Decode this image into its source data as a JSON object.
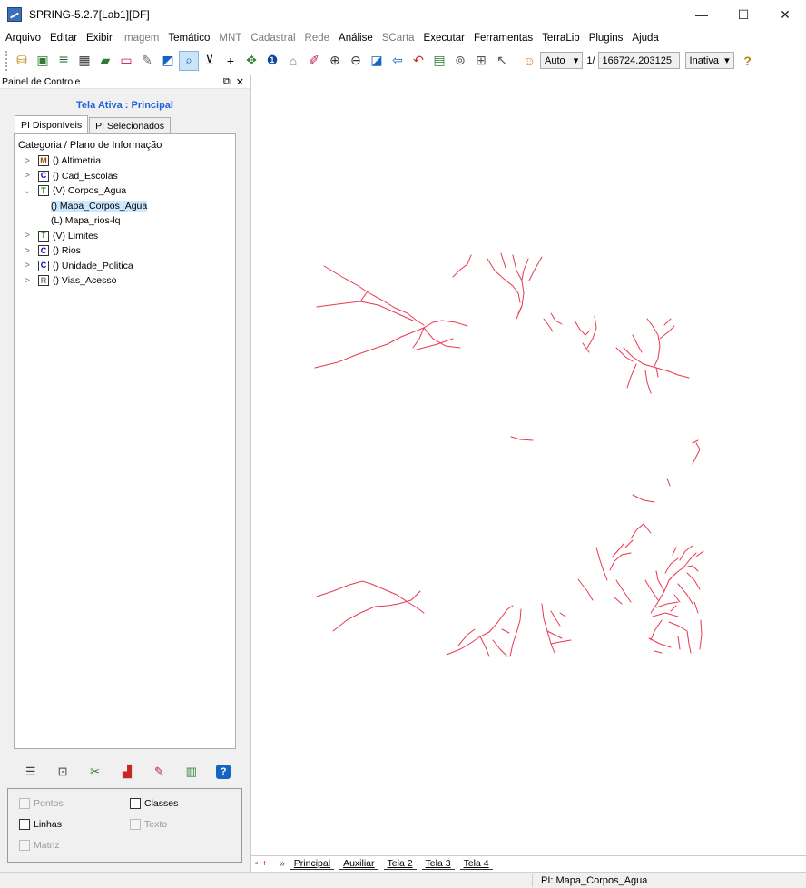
{
  "window": {
    "title": "SPRING-5.2.7[Lab1][DF]",
    "minimize": "—",
    "maximize": "☐",
    "close": "✕"
  },
  "menu": [
    {
      "label": "Arquivo",
      "enabled": true
    },
    {
      "label": "Editar",
      "enabled": true
    },
    {
      "label": "Exibir",
      "enabled": true
    },
    {
      "label": "Imagem",
      "enabled": false
    },
    {
      "label": "Temático",
      "enabled": true
    },
    {
      "label": "MNT",
      "enabled": false
    },
    {
      "label": "Cadastral",
      "enabled": false
    },
    {
      "label": "Rede",
      "enabled": false
    },
    {
      "label": "Análise",
      "enabled": true
    },
    {
      "label": "SCarta",
      "enabled": false
    },
    {
      "label": "Executar",
      "enabled": true
    },
    {
      "label": "Ferramentas",
      "enabled": true
    },
    {
      "label": "TerraLib",
      "enabled": true
    },
    {
      "label": "Plugins",
      "enabled": true
    },
    {
      "label": "Ajuda",
      "enabled": true
    }
  ],
  "toolbar": {
    "zoom_mode": "Auto",
    "scale_prefix": "1/",
    "scale_value": "166724.203125",
    "status_combo": "Inativa",
    "help_glyph": "?"
  },
  "panel": {
    "title": "Painel de Controle",
    "screen_title": "Tela Ativa : Principal",
    "tabs": [
      "PI Disponíveis",
      "PI Selecionados"
    ],
    "tree_header": "Categoria / Plano de Informação",
    "categories": [
      {
        "chevron": ">",
        "type": "M",
        "label": "() Altimetria"
      },
      {
        "chevron": ">",
        "type": "C",
        "label": "() Cad_Escolas"
      },
      {
        "chevron": "v",
        "type": "T",
        "label": "(V) Corpos_Agua"
      },
      {
        "chevron": ">",
        "type": "T",
        "label": "(V) Limites"
      },
      {
        "chevron": ">",
        "type": "C",
        "label": "() Rios"
      },
      {
        "chevron": ">",
        "type": "C",
        "label": "() Unidade_Politica"
      },
      {
        "chevron": ">",
        "type": "R",
        "label": "() Vias_Acesso"
      }
    ],
    "subitems": [
      {
        "label": "() Mapa_Corpos_Agua",
        "selected": true
      },
      {
        "label": "(L) Mapa_rios-lq",
        "selected": false
      }
    ],
    "options": {
      "pontos": "Pontos",
      "classes": "Classes",
      "linhas": "Linhas",
      "texto": "Texto",
      "matriz": "Matriz"
    }
  },
  "screen_tabs": [
    "Principal",
    "Auxiliar",
    "Tela 2",
    "Tela 3",
    "Tela 4"
  ],
  "status": "PI: Mapa_Corpos_Agua",
  "colors": {
    "rivers": "#e8384f",
    "highlight": "#cce8ff",
    "link": "#1e63d6"
  }
}
